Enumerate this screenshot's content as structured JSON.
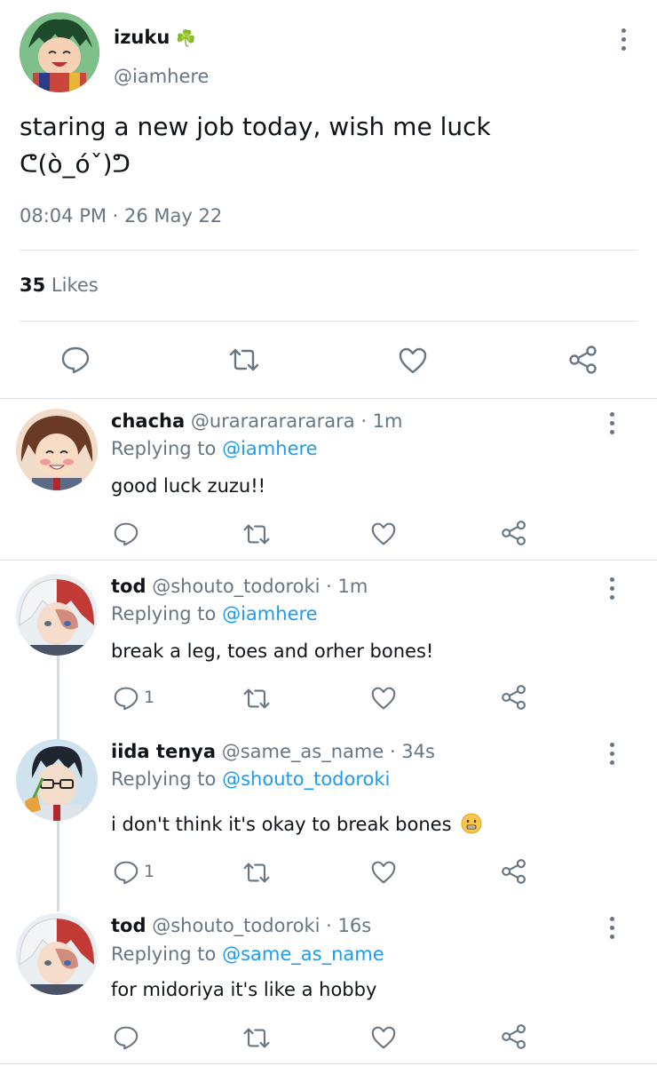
{
  "main_tweet": {
    "display_name": "izuku",
    "name_emoji": "☘️",
    "handle": "@iamhere",
    "text_line1": "staring a new job today, wish me luck",
    "text_line2": "ᕦ(ò_óˇ)ᕤ",
    "timestamp": "08:04 PM · 26 May 22",
    "likes_count": "35",
    "likes_label": "Likes"
  },
  "replies": [
    {
      "display_name": "chacha",
      "handle": "@urarararararara",
      "time": "· 1m",
      "replying_label": "Replying to",
      "replying_to": "@iamhere",
      "text": "good luck zuzu!!",
      "reply_count": ""
    },
    {
      "display_name": "tod",
      "handle": "@shouto_todoroki",
      "time": "· 1m",
      "replying_label": "Replying to",
      "replying_to": "@iamhere",
      "text": "break a leg, toes and orher bones!",
      "reply_count": "1"
    },
    {
      "display_name": "iida tenya",
      "handle": "@same_as_name",
      "time": "· 34s",
      "replying_label": "Replying to",
      "replying_to": "@shouto_todoroki",
      "text": "i don't think it's okay to break bones",
      "reply_count": "1"
    },
    {
      "display_name": "tod",
      "handle": "@shouto_todoroki",
      "time": "· 16s",
      "replying_label": "Replying to",
      "replying_to": "@same_as_name",
      "text": "for midoriya it's like a hobby",
      "reply_count": ""
    }
  ],
  "colors": {
    "link": "#1d9bf0",
    "muted": "#687684",
    "divider": "#dde3e8"
  }
}
